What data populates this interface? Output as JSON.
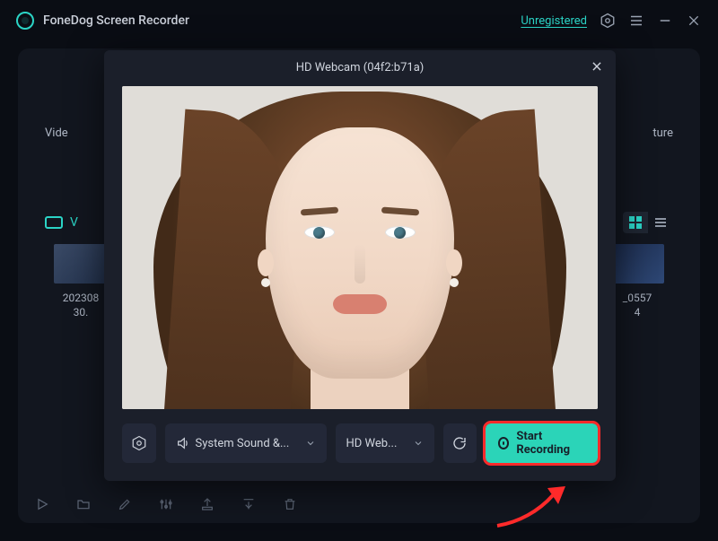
{
  "app": {
    "title": "FoneDog Screen Recorder"
  },
  "titlebar": {
    "badge": "Unregistered"
  },
  "background": {
    "left_card_label": "Vide",
    "right_card_label": "ture",
    "tabs_label": "V",
    "file_left_line1": "202308",
    "file_left_line2": "30.",
    "file_right_line1": "_0557",
    "file_right_line2": "4"
  },
  "modal": {
    "title": "HD Webcam (04f2:b71a)",
    "sound_dropdown": "System Sound &...",
    "webcam_dropdown": "HD Web...",
    "start_button": "Start Recording"
  }
}
